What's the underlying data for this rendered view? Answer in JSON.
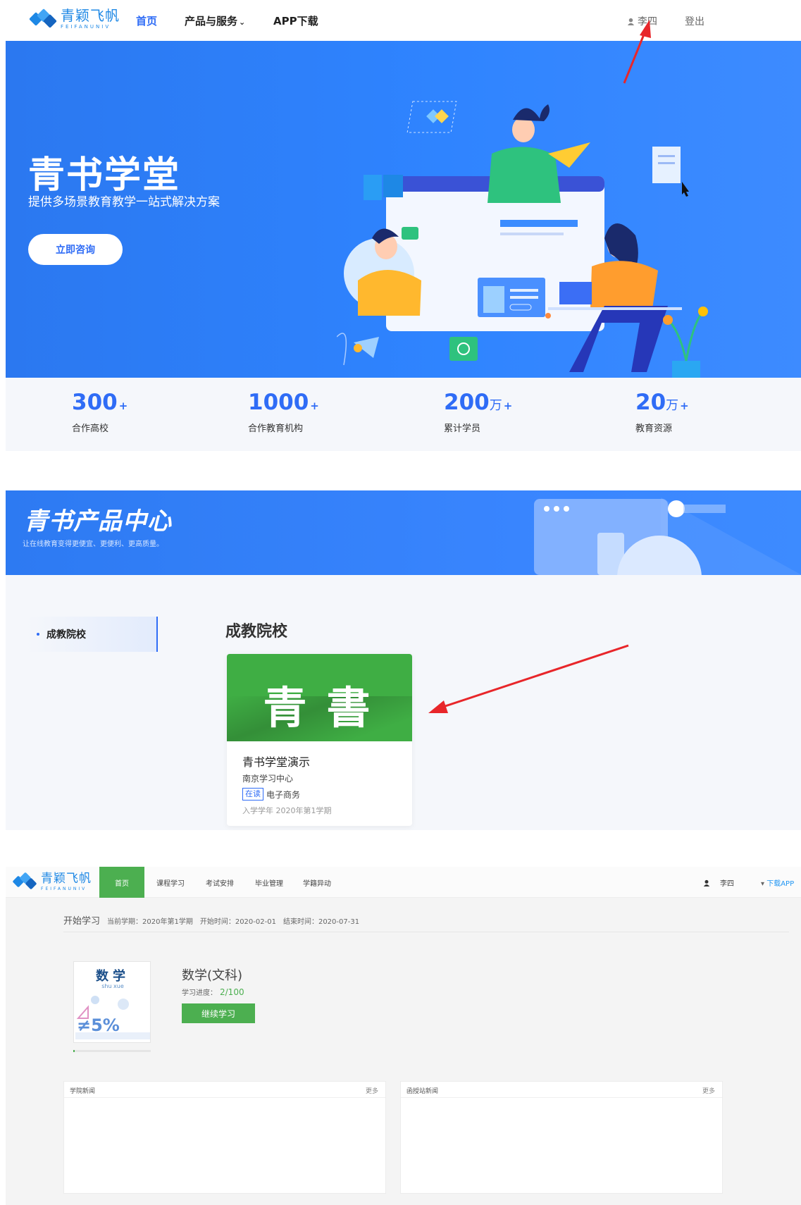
{
  "brand": {
    "name_cn": "青颖飞帆",
    "name_en": "FEIFANUNIV"
  },
  "nav": {
    "items": [
      {
        "label": "首页",
        "active": true
      },
      {
        "label": "产品与服务",
        "has_dropdown": true
      },
      {
        "label": "APP下载"
      }
    ],
    "user": "李四",
    "logout": "登出"
  },
  "hero": {
    "title": "青书学堂",
    "subtitle": "提供多场景教育教学一站式解决方案",
    "button": "立即咨询"
  },
  "stats": [
    {
      "value": "300",
      "unit": "",
      "plus": "+",
      "label": "合作高校"
    },
    {
      "value": "1000",
      "unit": "",
      "plus": "+",
      "label": "合作教育机构"
    },
    {
      "value": "200",
      "unit": "万",
      "plus": "+",
      "label": "累计学员"
    },
    {
      "value": "20",
      "unit": "万",
      "plus": "+",
      "label": "教育资源"
    }
  ],
  "product_center": {
    "title": "青书产品中心",
    "subtitle": "让在线教育变得更便宜、更便利、更高质量。",
    "sidebar_item": "成教院校",
    "section_title": "成教院校",
    "card": {
      "cover_text": "青書",
      "name": "青书学堂演示",
      "center": "南京学习中心",
      "status_tag": "在读",
      "major": "电子商务",
      "enroll": "入学学年 2020年第1学期"
    }
  },
  "lms": {
    "nav": {
      "items": [
        "首页",
        "课程学习",
        "考试安排",
        "毕业管理",
        "学籍异动"
      ],
      "user": "李四",
      "download": "下载APP"
    },
    "start": {
      "title": "开始学习",
      "term": "当前学期：2020年第1学期",
      "start_time": "开始时间：2020-02-01",
      "end_time": "结束时间：2020-07-31"
    },
    "course": {
      "cover_title": "数学",
      "cover_pinyin": "shu xue",
      "cover_formula": "≠5%",
      "name": "数学(文科)",
      "progress_label": "学习进度：",
      "progress_value": "2/100",
      "progress_fraction": 0.02,
      "button": "继续学习"
    },
    "news": [
      {
        "title": "学院新闻",
        "more": "更多"
      },
      {
        "title": "函授站新闻",
        "more": "更多"
      }
    ]
  },
  "colors": {
    "primary_blue": "#2f6cf6",
    "hero_blue": "#2b78f0",
    "green": "#4caf50",
    "arrow_red": "#e8262a"
  }
}
